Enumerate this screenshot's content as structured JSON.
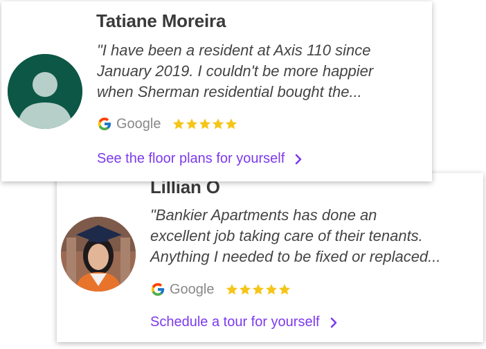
{
  "reviews": [
    {
      "name": "Tatiane Moreira",
      "quote_lines": [
        "\"I have been a resident at Axis 110 since",
        "January 2019. I couldn't be more happier",
        "when Sherman residential bought the..."
      ],
      "source": "Google",
      "rating": 5,
      "cta": "See the floor plans for yourself",
      "avatar": "default-person-icon"
    },
    {
      "name": "Lillian O",
      "quote_lines": [
        "\"Bankier Apartments has done an",
        "excellent job taking care of their tenants.",
        "Anything I needed to be fixed or replaced..."
      ],
      "source": "Google",
      "rating": 5,
      "cta": "Schedule a tour for yourself",
      "avatar": "photo-graduate"
    }
  ],
  "colors": {
    "accent": "#7c3aed",
    "star": "#f5c518",
    "avatar_default_bg": "#0d5746",
    "avatar_default_fg": "#b7cfc9"
  }
}
